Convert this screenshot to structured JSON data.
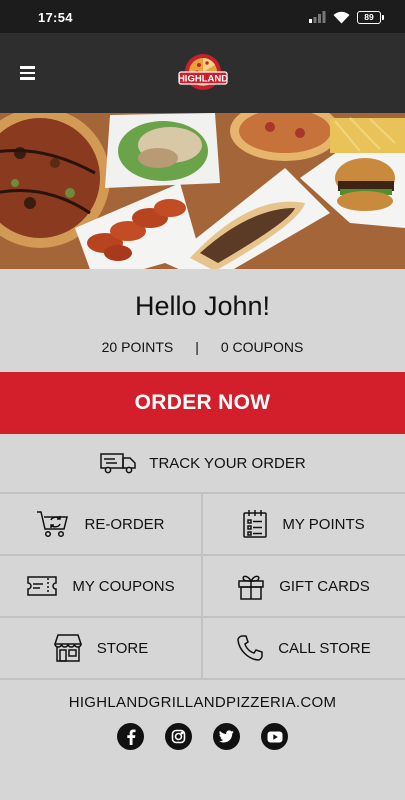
{
  "status_bar": {
    "time": "17:54",
    "battery_level": "89",
    "icons": [
      "signal-icon",
      "wifi-icon",
      "battery-icon"
    ]
  },
  "header": {
    "logo_text": "HIGHLAND",
    "menu_icon": "hamburger-menu-icon"
  },
  "hero": {
    "image": "food-spread-photo"
  },
  "greeting": {
    "title": "Hello John!",
    "points": "20 POINTS",
    "separator": "|",
    "coupons": "0 COUPONS"
  },
  "primary_action": {
    "label": "ORDER NOW",
    "color": "#d21f2b"
  },
  "track": {
    "label": "TRACK YOUR ORDER",
    "icon": "delivery-truck-icon"
  },
  "tiles": [
    {
      "label": "RE-ORDER",
      "icon": "cart-reload-icon"
    },
    {
      "label": "MY POINTS",
      "icon": "checklist-calendar-icon"
    },
    {
      "label": "MY COUPONS",
      "icon": "ticket-icon"
    },
    {
      "label": "GIFT CARDS",
      "icon": "gift-icon"
    },
    {
      "label": "STORE",
      "icon": "storefront-icon"
    },
    {
      "label": "CALL STORE",
      "icon": "phone-icon"
    }
  ],
  "footer": {
    "website": "HIGHLANDGRILLANDPIZZERIA.COM",
    "socials": [
      "facebook-icon",
      "instagram-icon",
      "twitter-icon",
      "youtube-icon"
    ]
  }
}
